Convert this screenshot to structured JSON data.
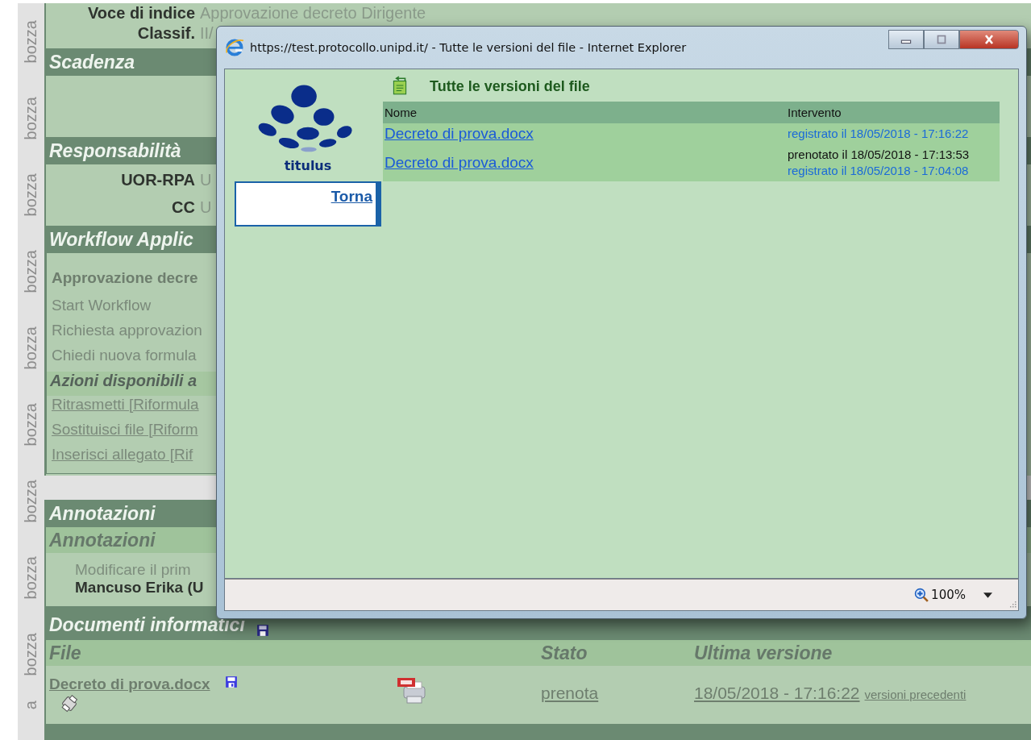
{
  "gutter": [
    "bozza",
    "bozza",
    "bozza",
    "bozza",
    "bozza",
    "bozza",
    "bozza",
    "bozza",
    "bozza",
    "a"
  ],
  "page": {
    "fields_top": [
      {
        "label": "Voce di indice",
        "value": "Approvazione decreto Dirigente"
      },
      {
        "label": "Classif.",
        "value": "II/"
      }
    ],
    "scadenza": {
      "title": "Scadenza"
    },
    "responsabilita": {
      "title": "Responsabilità",
      "fields": [
        {
          "label": "UOR-RPA",
          "value": "U"
        },
        {
          "label": "CC",
          "value": "U"
        }
      ]
    },
    "workflow": {
      "title": "Workflow Applic",
      "name": "Approvazione decre",
      "steps": [
        "Start Workflow",
        "Richiesta approvazion",
        "Chiedi nuova formula"
      ],
      "actions_title": "Azioni disponibili a",
      "actions": [
        "Ritrasmetti [Riformula",
        "Sostituisci file [Riform",
        "Inserisci allegato [Rif"
      ]
    },
    "annotazioni": {
      "title": "Annotazioni",
      "subtitle": "Annotazioni",
      "text": "Modificare il prim",
      "author": "Mancuso Erika (U"
    },
    "documenti": {
      "title": "Documenti informatici",
      "columns": [
        "File",
        "Stato",
        "Ultima versione"
      ],
      "rows": [
        {
          "file": "Decreto di prova.docx",
          "stato": "prenota",
          "ultima": "18/05/2018 - 17:16:22",
          "previous": "versioni precedenti"
        }
      ]
    }
  },
  "popup": {
    "title": "https://test.protocollo.unipd.it/ - Tutte le versioni del file - Internet Explorer",
    "logo": "titulus",
    "back": "Torna",
    "heading": "Tutte le versioni del file",
    "columns": [
      "Nome",
      "Intervento"
    ],
    "rows": [
      {
        "name": "Decreto di prova.docx",
        "events": [
          {
            "text": "registrato il 18/05/2018 - 17:16:22",
            "link": true
          }
        ]
      },
      {
        "name": "Decreto di prova.docx",
        "events": [
          {
            "text": "prenotato il 18/05/2018 - 17:13:53",
            "link": false
          },
          {
            "text": "registrato il 18/05/2018 - 17:04:08",
            "link": true
          }
        ]
      }
    ],
    "zoom": "100%"
  }
}
